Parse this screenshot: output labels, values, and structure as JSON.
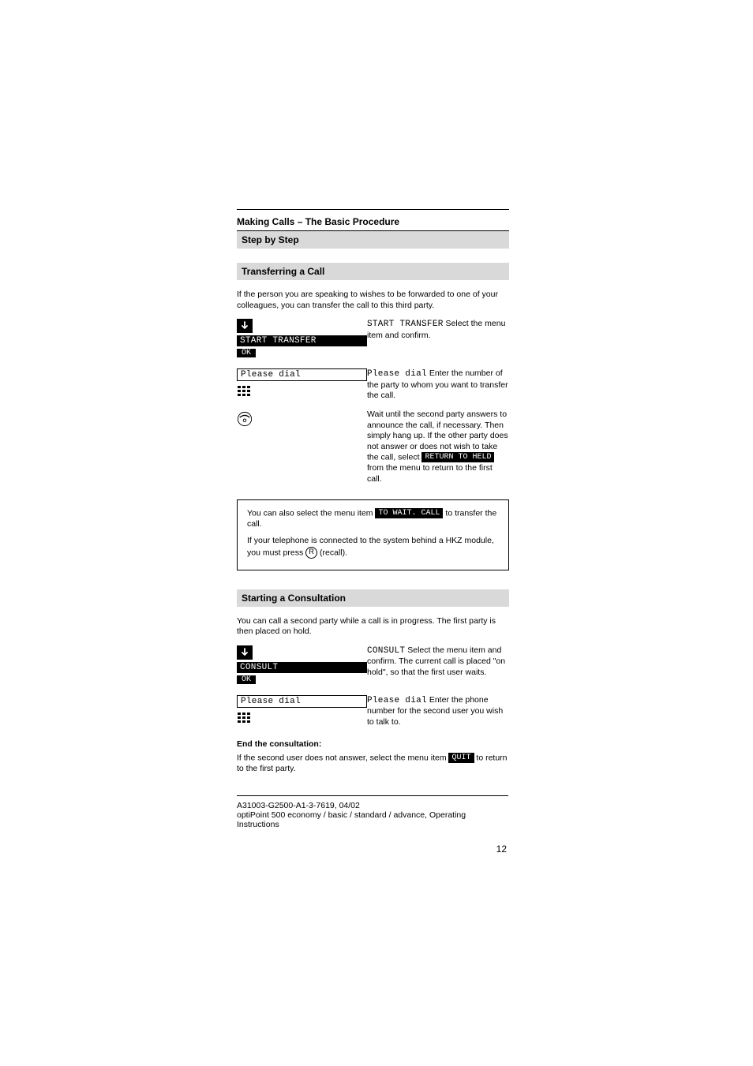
{
  "header": {
    "main_title": "Making Calls – The Basic Procedure",
    "subtitle": "Step by Step"
  },
  "section1": {
    "title": "Transferring a Call",
    "intro": "If the person you are speaking to wishes to be forwarded to one of your colleagues, you can transfer the call to this third party.",
    "step1_left": "START TRANSFER",
    "step1_left_ok": "OK",
    "step1_right_lcd": "START TRANSFER",
    "step1_right_text": " Select the menu item and confirm.",
    "step2_left": "Please dial",
    "step2_right_lcd": "Please dial",
    "step2_right_text": " Enter the number of the party to whom you want to transfer the call.",
    "step3_right_text": "Wait until the second party answers to announce the call, if necessary. Then simply hang up. If the other party does not answer or does not wish to take the call, select ",
    "step3_right_lcd": "RETURN TO HELD",
    "step3_right_text_suffix": " from the menu to return to the first call."
  },
  "note1": {
    "line1_prefix": "You can also select the menu item ",
    "line1_lcd": "TO WAIT. CALL",
    "line1_suffix": " to transfer the call.",
    "line2_prefix": "If your telephone is connected to the system behind a HKZ module, you must press ",
    "line2_key": "R",
    "line2_suffix": " (recall)."
  },
  "section2": {
    "title": "Starting a Consultation",
    "intro": "You can call a second party while a call is in progress. The first party is then placed on hold.",
    "step1_left": "CONSULT",
    "step1_left_ok": "OK",
    "step1_right_lcd": "CONSULT",
    "step1_right_text": " Select the menu item and confirm. The current call is placed \"on hold\", so that the first user waits.",
    "step2_left": "Please dial",
    "step2_right_lcd": "Please dial",
    "step2_right_text": " Enter the phone number for the second user you wish to talk to.",
    "end_para_1": "End the consultation:",
    "end_para_2_prefix": "If the second user does not answer, select the menu item ",
    "end_para_2_lcd": "QUIT",
    "end_para_2_suffix": " to return to the first party."
  },
  "footer": {
    "text": "A31003-G2500-A1-3-7619, 04/02",
    "text2": "optiPoint 500 economy / basic / standard / advance, Operating Instructions"
  },
  "page_number": "12"
}
